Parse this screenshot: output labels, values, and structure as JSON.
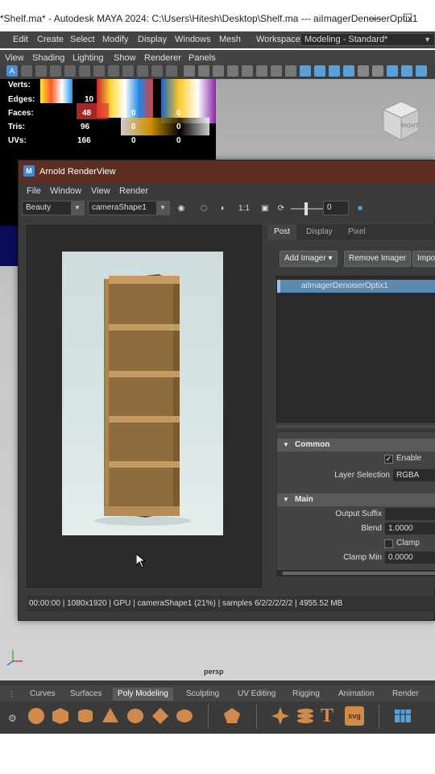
{
  "window": {
    "title": "*Shelf.ma* - Autodesk MAYA 2024: C:\\Users\\Hitesh\\Desktop\\Shelf.ma   ---   aiImagerDenoiserOptix1"
  },
  "menubar": [
    "Edit",
    "Create",
    "Select",
    "Modify",
    "Display",
    "Windows",
    "Mesh"
  ],
  "workspace": {
    "label": "Workspace:",
    "value": "Modeling - Standard*"
  },
  "panel_menu": [
    "View",
    "Shading",
    "Lighting",
    "Show",
    "Renderer",
    "Panels"
  ],
  "hud": {
    "rows": [
      {
        "label": "Verts:",
        "v1": "",
        "v2": "",
        "v3": ""
      },
      {
        "label": "Edges:",
        "v1": "10",
        "v2": "",
        "v3": ""
      },
      {
        "label": "Faces:",
        "v1": "48",
        "v2": "0",
        "v3": "0"
      },
      {
        "label": "Tris:",
        "v1": "96",
        "v2": "0",
        "v3": "0"
      },
      {
        "label": "UVs:",
        "v1": "166",
        "v2": "0",
        "v3": "0"
      }
    ]
  },
  "viewcube_label": "RIGHT",
  "viewport_label": "persp",
  "renderview": {
    "title": "Arnold RenderView",
    "menu": [
      "File",
      "Window",
      "View",
      "Render"
    ],
    "aov": "Beauty",
    "camera": "cameraShape1",
    "ratio": "1:1",
    "exposure": "0",
    "status": "00:00:00 | 1080x1920 | GPU | cameraShape1 (21%) | samples 6/2/2/2/2/2 | 4955.52 MB",
    "tabs": [
      "Post",
      "Display",
      "Pixel"
    ],
    "buttons": {
      "add": "Add Imager ▾",
      "remove": "Remove Imager",
      "import": "Impo"
    },
    "imager": "aiImagerDenoiserOptix1",
    "sections": {
      "common": "Common",
      "main": "Main"
    },
    "attrs": {
      "enable": "Enable",
      "layer_selection_label": "Layer Selection",
      "layer_selection_value": "RGBA",
      "output_suffix_label": "Output Suffix",
      "blend_label": "Blend",
      "blend_value": "1.0000",
      "clamp": "Clamp",
      "clamp_min_label": "Clamp Min",
      "clamp_min_value": "0.0000"
    }
  },
  "shelf": {
    "tabs": [
      "Curves",
      "Surfaces",
      "Poly Modeling",
      "Sculpting",
      "UV Editing",
      "Rigging",
      "Animation",
      "Render"
    ],
    "active": "Poly Modeling"
  }
}
